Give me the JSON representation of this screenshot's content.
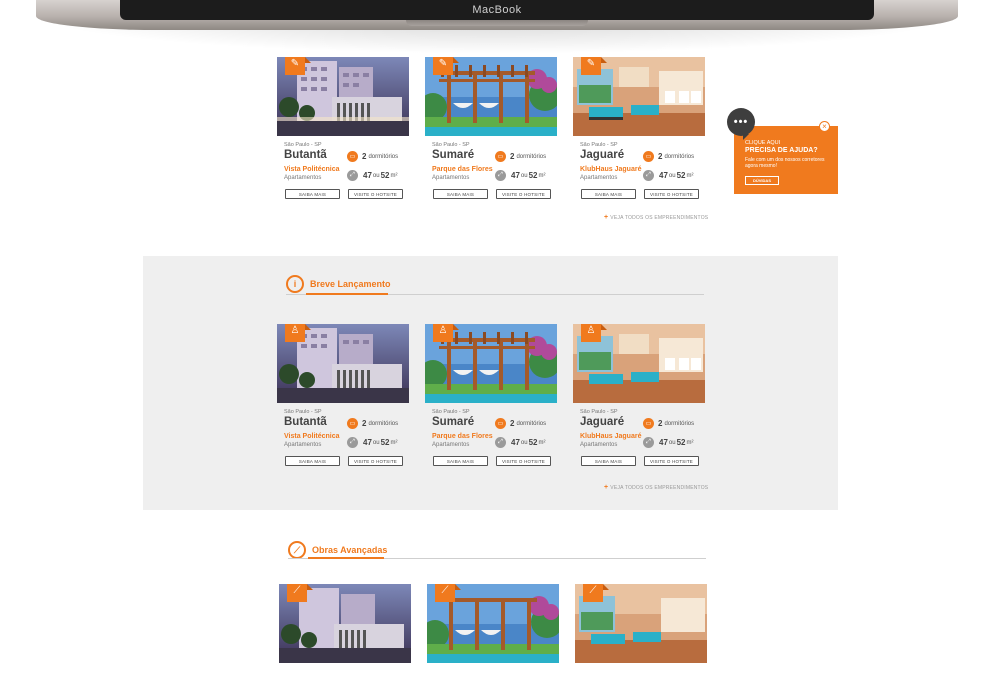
{
  "laptop": {
    "brand": "MacBook"
  },
  "colors": {
    "accent": "#f07a1e",
    "band": "#efefef"
  },
  "sections": {
    "s1": {
      "cards": [
        {
          "city": "São Paulo - SP",
          "name": "Butantã",
          "project": "Vista Politécnica",
          "type": "Apartamentos",
          "beds": "2",
          "beds_label": "dormitórios",
          "area_a": "47",
          "area_or": "ou",
          "area_b": "52",
          "area_unit": "m²",
          "btn_more": "SAIBA MAIS",
          "btn_site": "VISITE O HOTSITE",
          "badge_icon": "megaphone-icon"
        },
        {
          "city": "São Paulo - SP",
          "name": "Sumaré",
          "project": "Parque das Flores",
          "type": "Apartamentos",
          "beds": "2",
          "beds_label": "dormitórios",
          "area_a": "47",
          "area_or": "ou",
          "area_b": "52",
          "area_unit": "m²",
          "btn_more": "SAIBA MAIS",
          "btn_site": "VISITE O HOTSITE",
          "badge_icon": "megaphone-icon"
        },
        {
          "city": "São Paulo - SP",
          "name": "Jaguaré",
          "project": "KlubHaus Jaguaré",
          "type": "Apartamentos",
          "beds": "2",
          "beds_label": "dormitórios",
          "area_a": "47",
          "area_or": "ou",
          "area_b": "52",
          "area_unit": "m²",
          "btn_more": "SAIBA MAIS",
          "btn_site": "VISITE O HOTSITE",
          "badge_icon": "megaphone-icon"
        }
      ],
      "see_all": "VEJA TODOS OS EMPREENDIMENTOS"
    },
    "s2": {
      "title": "Breve Lançamento",
      "cards": [
        {
          "city": "São Paulo - SP",
          "name": "Butantã",
          "project": "Vista Politécnica",
          "type": "Apartamentos",
          "beds": "2",
          "beds_label": "dormitórios",
          "area_a": "47",
          "area_or": "ou",
          "area_b": "52",
          "area_unit": "m²",
          "btn_more": "SAIBA MAIS",
          "btn_site": "VISITE O HOTSITE",
          "badge_icon": "bottle-icon"
        },
        {
          "city": "São Paulo - SP",
          "name": "Sumaré",
          "project": "Parque das Flores",
          "type": "Apartamentos",
          "beds": "2",
          "beds_label": "dormitórios",
          "area_a": "47",
          "area_or": "ou",
          "area_b": "52",
          "area_unit": "m²",
          "btn_more": "SAIBA MAIS",
          "btn_site": "VISITE O HOTSITE",
          "badge_icon": "bottle-icon"
        },
        {
          "city": "São Paulo - SP",
          "name": "Jaguaré",
          "project": "KlubHaus Jaguaré",
          "type": "Apartamentos",
          "beds": "2",
          "beds_label": "dormitórios",
          "area_a": "47",
          "area_or": "ou",
          "area_b": "52",
          "area_unit": "m²",
          "btn_more": "SAIBA MAIS",
          "btn_site": "VISITE O HOTSITE",
          "badge_icon": "bottle-icon"
        }
      ],
      "see_all": "VEJA TODOS OS EMPREENDIMENTOS"
    },
    "s3": {
      "title": "Obras Avançadas",
      "badge_icon": "trowel-icon"
    }
  },
  "help": {
    "bubble_icon": "chat-bubble-icon",
    "line1": "CLIQUE AQUI",
    "line2": "PRECISA DE AJUDA?",
    "line3": "Fale com um dos nossos corretores agora mesmo!",
    "button": "DÚVIDAS",
    "close": "×"
  }
}
